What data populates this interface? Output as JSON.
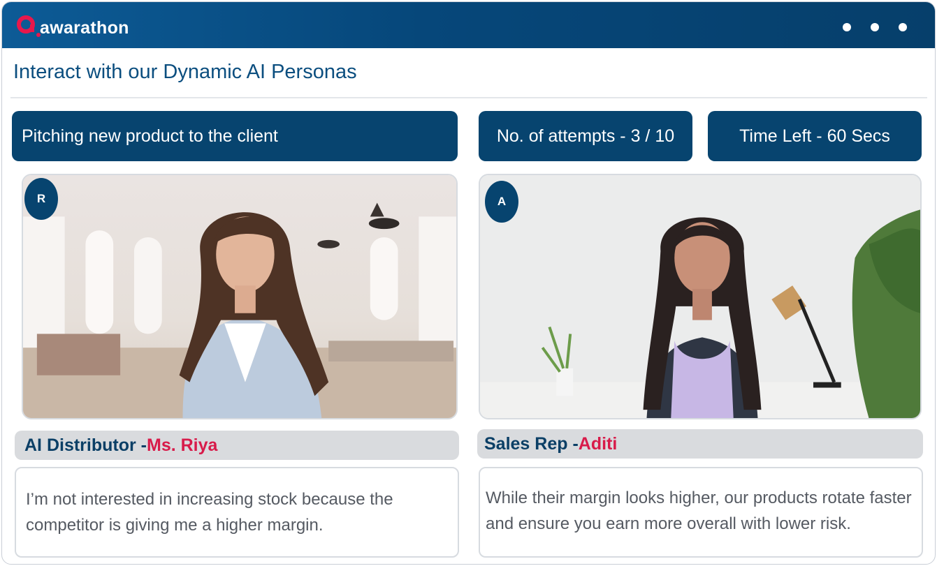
{
  "brand": {
    "name": "awarathon",
    "accent_color": "#e8184c",
    "bar_color": "#07446f"
  },
  "window_controls": {
    "icon": "more-dots-icon"
  },
  "page": {
    "heading": "Interact with our Dynamic AI Personas"
  },
  "session": {
    "scenario": "Pitching new product to the client",
    "attempts": "No. of attempts - 3 / 10",
    "time_left": "Time Left - 60 Secs"
  },
  "participants": {
    "ai": {
      "initial": "R",
      "role": "AI Distributor - ",
      "name": "Ms. Riya",
      "message": " I’m not interested in increasing stock because the competitor is giving me a higher margin."
    },
    "user": {
      "initial": "A",
      "role": "Sales Rep - ",
      "name": "Aditi",
      "message": "While their margin looks higher, our products rotate faster and ensure you earn more overall with lower risk."
    }
  }
}
